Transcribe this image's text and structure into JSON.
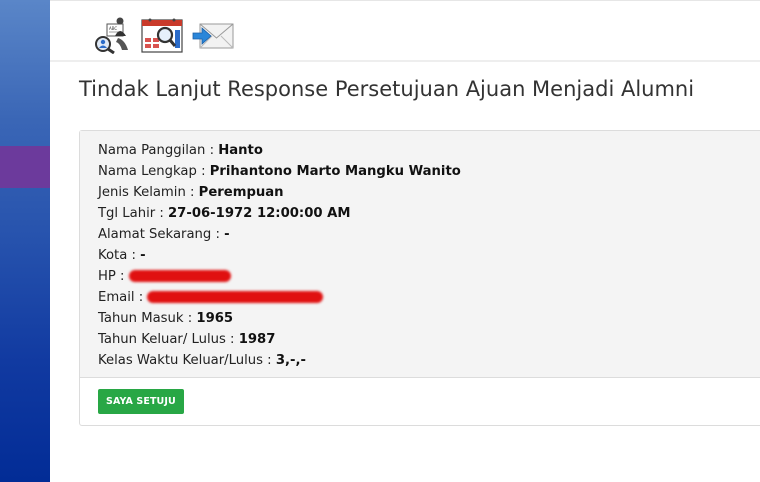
{
  "toolbar": {
    "icons": [
      "alumni-search-icon",
      "calendar-search-icon",
      "send-mail-icon"
    ]
  },
  "page": {
    "title": "Tindak Lanjut Response Persetujuan Ajuan Menjadi Alumni"
  },
  "details": [
    {
      "label": "Nama Panggilan :",
      "value": "Hanto"
    },
    {
      "label": "Nama Lengkap :",
      "value": "Prihantono Marto Mangku Wanito"
    },
    {
      "label": "Jenis Kelamin :",
      "value": "Perempuan"
    },
    {
      "label": "Tgl Lahir :",
      "value": "27-06-1972 12:00:00 AM"
    },
    {
      "label": "Alamat Sekarang :",
      "value": "-"
    },
    {
      "label": "Kota :",
      "value": "-"
    },
    {
      "label": "HP :",
      "value": ""
    },
    {
      "label": "Email :",
      "value": ""
    },
    {
      "label": "Tahun Masuk :",
      "value": "1965"
    },
    {
      "label": "Tahun Keluar/ Lulus :",
      "value": "1987"
    },
    {
      "label": "Kelas Waktu Keluar/Lulus :",
      "value": "3,-,-"
    }
  ],
  "actions": {
    "approve_label": "SAYA SETUJU",
    "approve_color": "#28a745"
  }
}
